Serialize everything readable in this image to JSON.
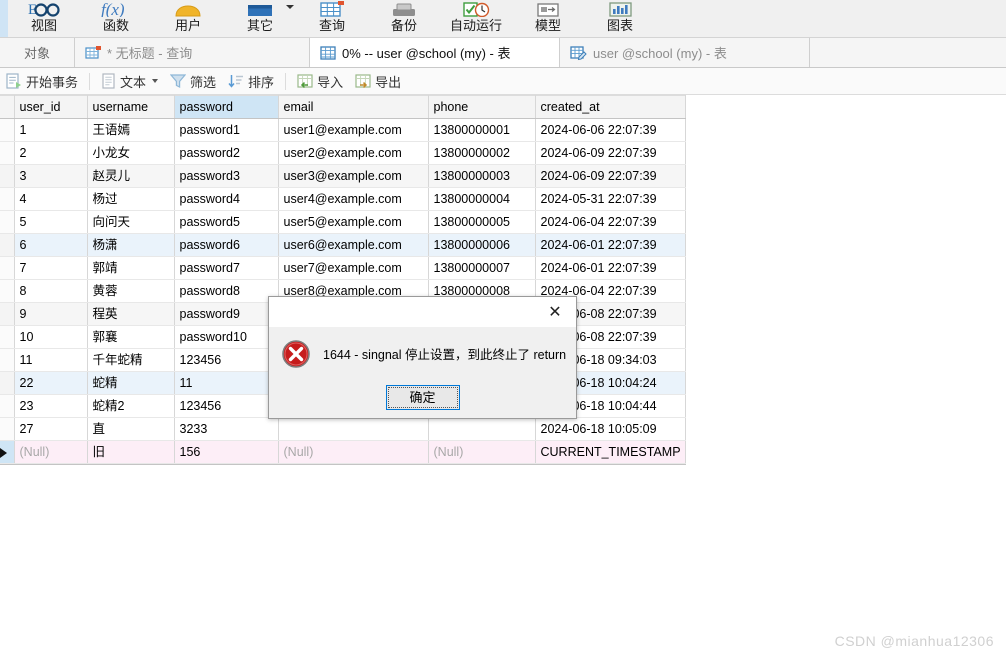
{
  "ribbon": {
    "items": [
      {
        "label": "视图",
        "icon": "glasses-icon",
        "caret": false
      },
      {
        "label": "函数",
        "icon": "function-icon",
        "caret": false
      },
      {
        "label": "用户",
        "icon": "user-icon",
        "caret": false
      },
      {
        "label": "其它",
        "icon": "other-icon",
        "caret": true
      },
      {
        "label": "查询",
        "icon": "query-grid-icon",
        "caret": false
      },
      {
        "label": "备份",
        "icon": "backup-icon",
        "caret": false
      },
      {
        "label": "自动运行",
        "icon": "autorun-icon",
        "caret": false
      },
      {
        "label": "模型",
        "icon": "model-icon",
        "caret": false
      },
      {
        "label": "图表",
        "icon": "chart-icon",
        "caret": false
      }
    ]
  },
  "tabbar": {
    "object_tab": "对象",
    "tabs": [
      {
        "label": "* 无标题 - 查询",
        "icon": "query-tab-icon",
        "active": false
      },
      {
        "label": "0% -- user @school (my) - 表",
        "icon": "table-tab-icon",
        "active": true
      },
      {
        "label": "user @school (my) - 表",
        "icon": "table-edit-tab-icon",
        "active": false
      }
    ]
  },
  "actionbar": {
    "items": [
      {
        "label": "开始事务",
        "icon": "begin-transaction-icon",
        "caret": false,
        "sep_after": true
      },
      {
        "label": "文本",
        "icon": "text-icon",
        "caret": true,
        "sep_after": false
      },
      {
        "label": "筛选",
        "icon": "filter-icon",
        "caret": false,
        "sep_after": false
      },
      {
        "label": "排序",
        "icon": "sort-icon",
        "caret": false,
        "sep_after": true
      },
      {
        "label": "导入",
        "icon": "import-icon",
        "caret": false,
        "sep_after": false
      },
      {
        "label": "导出",
        "icon": "export-icon",
        "caret": false,
        "sep_after": false
      }
    ]
  },
  "grid": {
    "columns": [
      "user_id",
      "username",
      "password",
      "email",
      "phone",
      "created_at"
    ],
    "selected_column": "password",
    "rows": [
      {
        "cells": [
          "1",
          "王语嫣",
          "password1",
          "user1@example.com",
          "13800000001",
          "2024-06-06 22:07:39"
        ],
        "style": ""
      },
      {
        "cells": [
          "2",
          "小龙女",
          "password2",
          "user2@example.com",
          "13800000002",
          "2024-06-09 22:07:39"
        ],
        "style": ""
      },
      {
        "cells": [
          "3",
          "赵灵儿",
          "password3",
          "user3@example.com",
          "13800000003",
          "2024-06-09 22:07:39"
        ],
        "style": "alt"
      },
      {
        "cells": [
          "4",
          "杨过",
          "password4",
          "user4@example.com",
          "13800000004",
          "2024-05-31 22:07:39"
        ],
        "style": ""
      },
      {
        "cells": [
          "5",
          "向问天",
          "password5",
          "user5@example.com",
          "13800000005",
          "2024-06-04 22:07:39"
        ],
        "style": ""
      },
      {
        "cells": [
          "6",
          "杨潇",
          "password6",
          "user6@example.com",
          "13800000006",
          "2024-06-01 22:07:39"
        ],
        "style": "hl"
      },
      {
        "cells": [
          "7",
          "郭靖",
          "password7",
          "user7@example.com",
          "13800000007",
          "2024-06-01 22:07:39"
        ],
        "style": ""
      },
      {
        "cells": [
          "8",
          "黄蓉",
          "password8",
          "user8@example.com",
          "13800000008",
          "2024-06-04 22:07:39"
        ],
        "style": ""
      },
      {
        "cells": [
          "9",
          "程英",
          "password9",
          "",
          "",
          "2024-06-08 22:07:39"
        ],
        "style": "alt"
      },
      {
        "cells": [
          "10",
          "郭襄",
          "password10",
          "",
          "",
          "2024-06-08 22:07:39"
        ],
        "style": ""
      },
      {
        "cells": [
          "11",
          "千年蛇精",
          "123456",
          "",
          "",
          "2024-06-18 09:34:03"
        ],
        "style": ""
      },
      {
        "cells": [
          "22",
          "蛇精",
          "11",
          "",
          "",
          "2024-06-18 10:04:24"
        ],
        "style": "hl"
      },
      {
        "cells": [
          "23",
          "蛇精2",
          "123456",
          "",
          "",
          "2024-06-18 10:04:44"
        ],
        "style": ""
      },
      {
        "cells": [
          "27",
          "直",
          "3233",
          "",
          "",
          "2024-06-18 10:05:09"
        ],
        "style": ""
      },
      {
        "cells": [
          "(Null)",
          "旧",
          "156",
          "(Null)",
          "(Null)",
          "CURRENT_TIMESTAMP"
        ],
        "style": "newrow"
      }
    ]
  },
  "dialog": {
    "message": "1644 - singnal 停止设置，到此终止了 return",
    "ok_label": "确定",
    "close_label": "✕",
    "icon": "error-icon"
  },
  "watermark": {
    "text": "CSDN @mianhua12306"
  },
  "colors": {
    "accent": "#0078d7",
    "selected_header": "#cfe5f5",
    "new_row": "#fdeef7",
    "highlight_row": "#eaf3fb",
    "error_red": "#cc2222"
  }
}
